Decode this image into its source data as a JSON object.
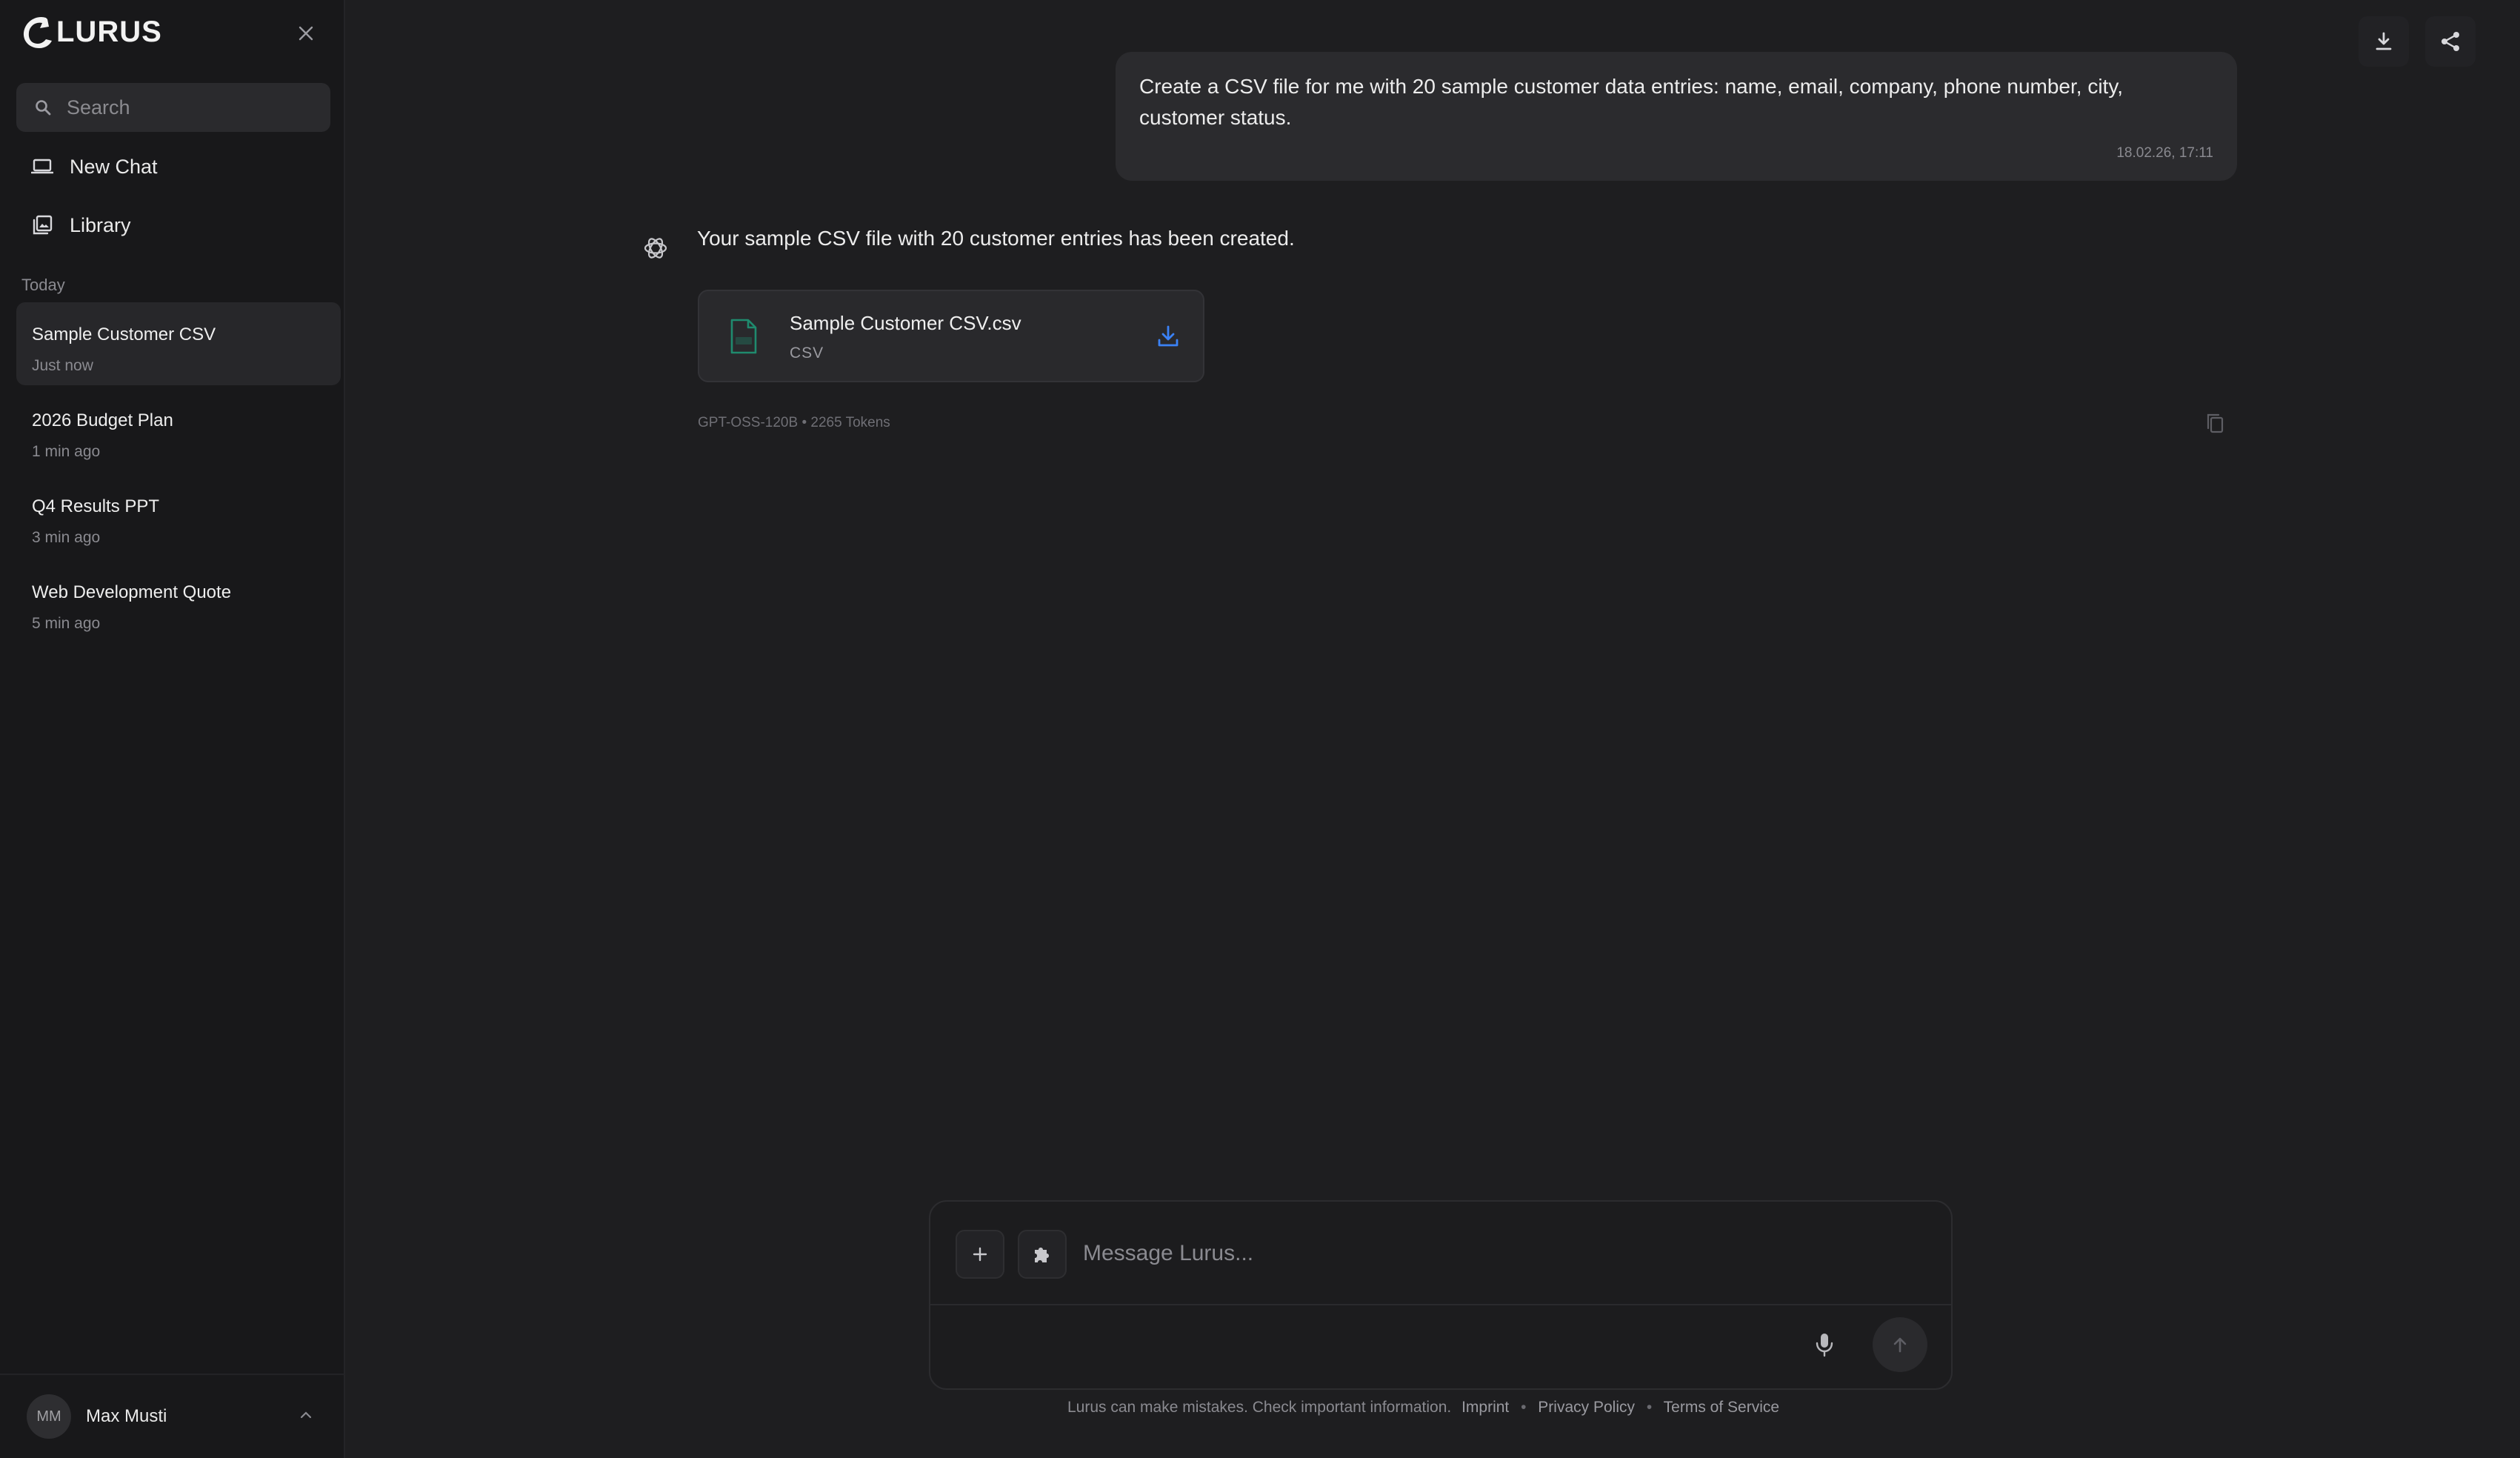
{
  "app": {
    "brand": "LURUS"
  },
  "sidebar": {
    "search_placeholder": "Search",
    "nav": [
      {
        "label": "New Chat",
        "icon": "laptop-icon"
      },
      {
        "label": "Library",
        "icon": "library-icon"
      }
    ],
    "section_label": "Today",
    "chats": [
      {
        "title": "Sample Customer CSV",
        "time": "Just now",
        "active": true
      },
      {
        "title": "2026 Budget Plan",
        "time": "1 min ago"
      },
      {
        "title": "Q4 Results PPT",
        "time": "3 min ago"
      },
      {
        "title": "Web Development Quote",
        "time": "5 min ago"
      }
    ],
    "user": {
      "initials": "MM",
      "name": "Max Musti"
    }
  },
  "conversation": {
    "user_message": {
      "text": "Create a CSV file for me with 20 sample customer data entries: name, email, company, phone number, city, customer status.",
      "timestamp": "18.02.26, 17:11"
    },
    "assistant_message": {
      "text": "Your sample CSV file with 20 customer entries has been created.",
      "file": {
        "name": "Sample Customer CSV.csv",
        "type": "CSV"
      },
      "meta": "GPT-OSS-120B • 2265 Tokens"
    }
  },
  "composer": {
    "placeholder": "Message Lurus..."
  },
  "footer": {
    "disclaimer": "Lurus can make mistakes. Check important information.",
    "links": [
      "Imprint",
      "Privacy Policy",
      "Terms of Service"
    ]
  },
  "colors": {
    "background": "#1e1e20",
    "sidebar": "#18181a",
    "accent_file": "#1f8a6e",
    "download_blue": "#3b82f6"
  }
}
